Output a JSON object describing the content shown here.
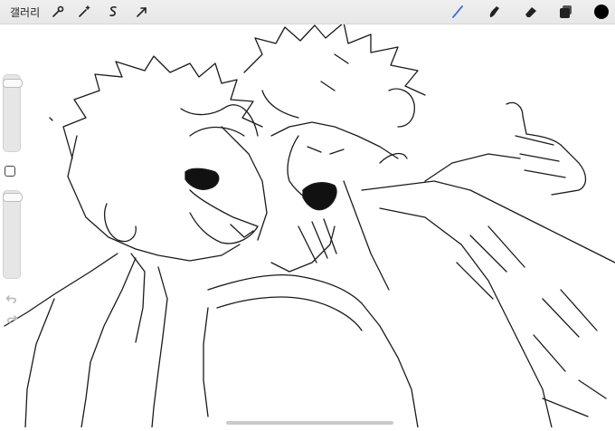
{
  "topbar": {
    "gallery_label": "갤러리"
  },
  "left_tools": [
    "wrench-icon",
    "magic-wand-icon",
    "selection-icon",
    "transform-arrow-icon"
  ],
  "right_tools": [
    "brush-icon",
    "smudge-icon",
    "eraser-icon",
    "layers-icon",
    "color-icon"
  ],
  "colors": {
    "active_tool": "#3b6fe0",
    "current_color": "#000000",
    "ink": "#1a1a1a"
  }
}
